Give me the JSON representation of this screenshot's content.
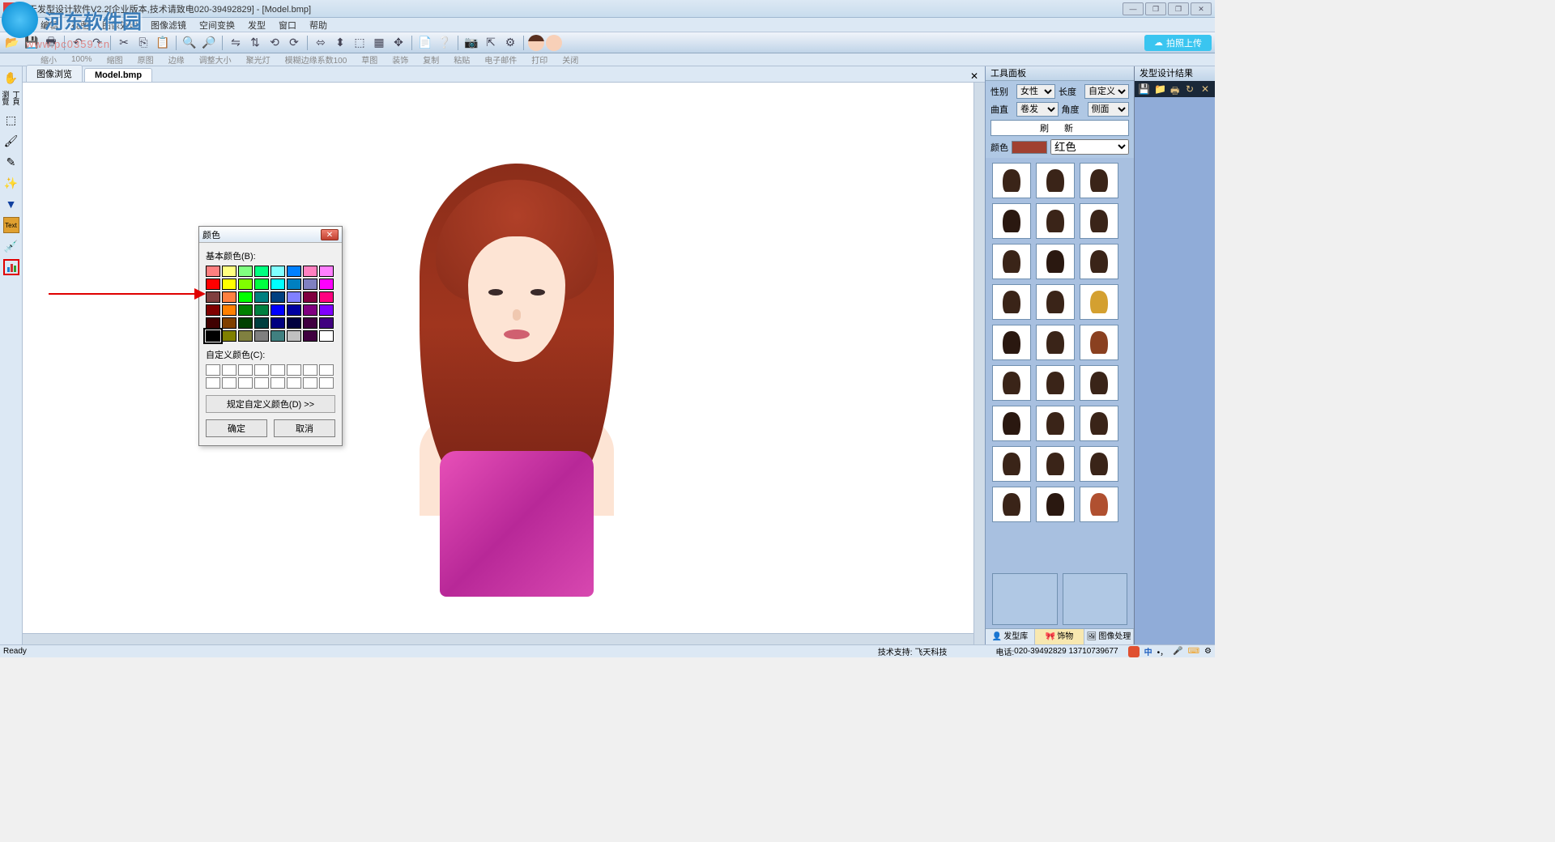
{
  "title": "飞天发型设计软件V2.2[企业版本,技术请致电020-39492829] - [Model.bmp]",
  "watermark": {
    "brand": "河东软件园",
    "url": "www.pc0359.cn"
  },
  "menu": [
    "文件",
    "编辑",
    "视图",
    "图像处理",
    "图像滤镜",
    "空间变换",
    "发型",
    "窗口",
    "帮助"
  ],
  "upload_label": "拍照上传",
  "sec_toolbar": [
    "缩小",
    "100%",
    "缩图",
    "原图",
    "边缘",
    "调整大小",
    "聚光灯",
    "模糊边缘系数100",
    "草图",
    "装饰",
    "复制",
    "粘贴",
    "电子邮件",
    "打印",
    "关闭"
  ],
  "tabs": [
    {
      "label": "图像浏览",
      "active": false
    },
    {
      "label": "Model.bmp",
      "active": true
    }
  ],
  "color_dialog": {
    "title": "颜色",
    "basic_label": "基本颜色(B):",
    "custom_label": "自定义颜色(C):",
    "define_btn": "规定自定义颜色(D) >>",
    "ok": "确定",
    "cancel": "取消",
    "basic_colors": [
      "#ff8080",
      "#ffff80",
      "#80ff80",
      "#00ff80",
      "#80ffff",
      "#0080ff",
      "#ff80c0",
      "#ff80ff",
      "#ff0000",
      "#ffff00",
      "#80ff00",
      "#00ff40",
      "#00ffff",
      "#0080c0",
      "#8080c0",
      "#ff00ff",
      "#804040",
      "#ff8040",
      "#00ff00",
      "#008080",
      "#004080",
      "#8080ff",
      "#800040",
      "#ff0080",
      "#800000",
      "#ff8000",
      "#008000",
      "#008040",
      "#0000ff",
      "#0000a0",
      "#800080",
      "#8000ff",
      "#400000",
      "#804000",
      "#004000",
      "#004040",
      "#000080",
      "#000040",
      "#400040",
      "#400080",
      "#000000",
      "#808000",
      "#808040",
      "#808080",
      "#408080",
      "#c0c0c0",
      "#400040",
      "#ffffff"
    ]
  },
  "right_panel": {
    "header": "工具面板",
    "filters": {
      "gender_label": "性别",
      "gender_value": "女性",
      "length_label": "长度",
      "length_value": "自定义",
      "curl_label": "曲直",
      "curl_value": "卷发",
      "angle_label": "角度",
      "angle_value": "侧面",
      "refresh": "刷 新",
      "color_label": "颜色",
      "color_value": "红色"
    },
    "panel_tabs": [
      "发型库",
      "饰物",
      "图像处理"
    ]
  },
  "result_panel": {
    "header": "发型设计结果"
  },
  "status": {
    "left": "Ready",
    "support": "技术支持: 飞天科技",
    "phone": "电话:",
    "phone_num": "020-39492829 13710739677"
  }
}
